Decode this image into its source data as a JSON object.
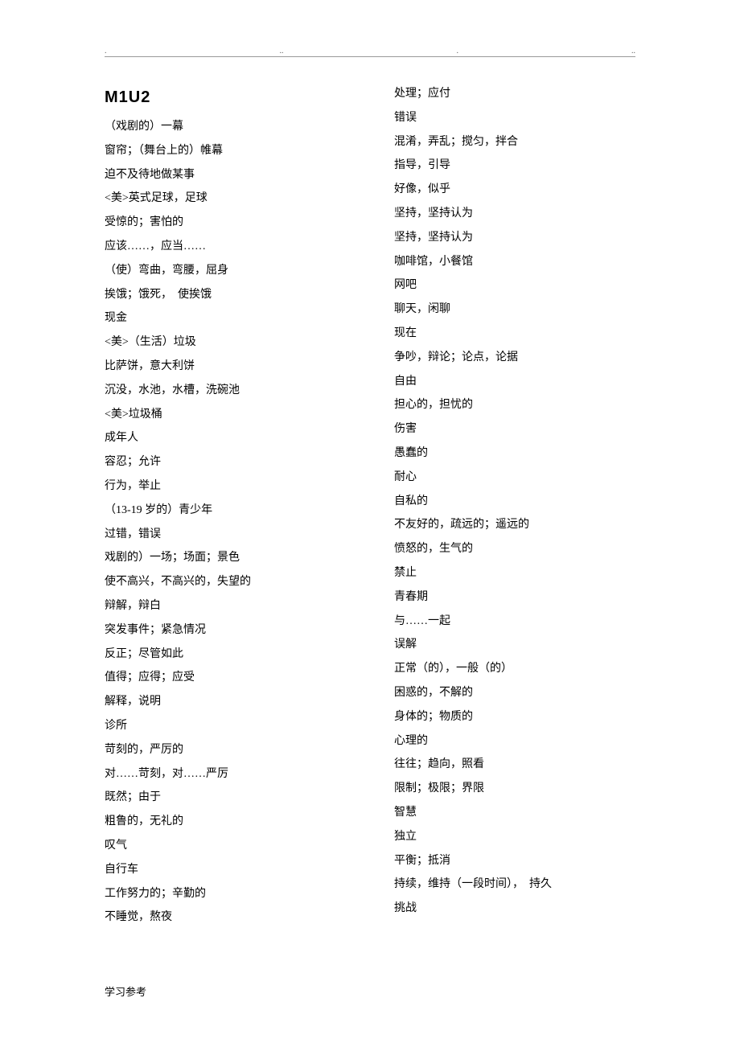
{
  "heading": "M1U2",
  "dots": [
    ".",
    "..",
    ".",
    ".."
  ],
  "left_column": [
    "（戏剧的）一幕",
    "窗帘；（舞台上的）帷幕",
    "迫不及待地做某事",
    "<美>英式足球，足球",
    "受惊的；害怕的",
    "应该……，应当……",
    "（使）弯曲，弯腰，屈身",
    "挨饿；饿死，　使挨饿",
    "现金",
    "<美>（生活）垃圾",
    "比萨饼，意大利饼",
    "沉没，水池，水槽，洗碗池",
    "<美>垃圾桶",
    "成年人",
    "容忍；允许",
    "行为，举止",
    "（13-19 岁的）青少年",
    "过错，错误",
    "戏剧的）一场；场面；景色",
    "使不高兴，不高兴的，失望的",
    "辩解，辩白",
    "突发事件；紧急情况",
    "反正；尽管如此",
    "值得；应得；应受",
    "解释，说明",
    "诊所",
    "苛刻的，严厉的",
    "对……苛刻，对……严厉",
    "既然；由于",
    "粗鲁的，无礼的",
    "叹气",
    "自行车",
    "工作努力的；辛勤的",
    "不睡觉，熬夜"
  ],
  "right_column": [
    "处理；应付",
    "错误",
    "混淆，弄乱；搅匀，拌合",
    "指导，引导",
    "好像，似乎",
    "坚持，坚持认为",
    "坚持，坚持认为",
    "咖啡馆，小餐馆",
    "网吧",
    "聊天，闲聊",
    "现在",
    "争吵，辩论；论点，论据",
    "自由",
    "担心的，担忧的",
    "伤害",
    "愚蠢的",
    "耐心",
    "自私的",
    "不友好的，疏远的；遥远的",
    "愤怒的，生气的",
    "禁止",
    "青春期",
    "与……一起",
    "误解",
    "正常（的），一般（的）",
    "困惑的，不解的",
    "身体的；物质的",
    "心理的",
    "往往；趋向，照看",
    "限制；极限；界限",
    "智慧",
    "独立",
    "平衡；抵消",
    "持续，维持（一段时间），　持久",
    "挑战"
  ],
  "footer": "学习参考"
}
